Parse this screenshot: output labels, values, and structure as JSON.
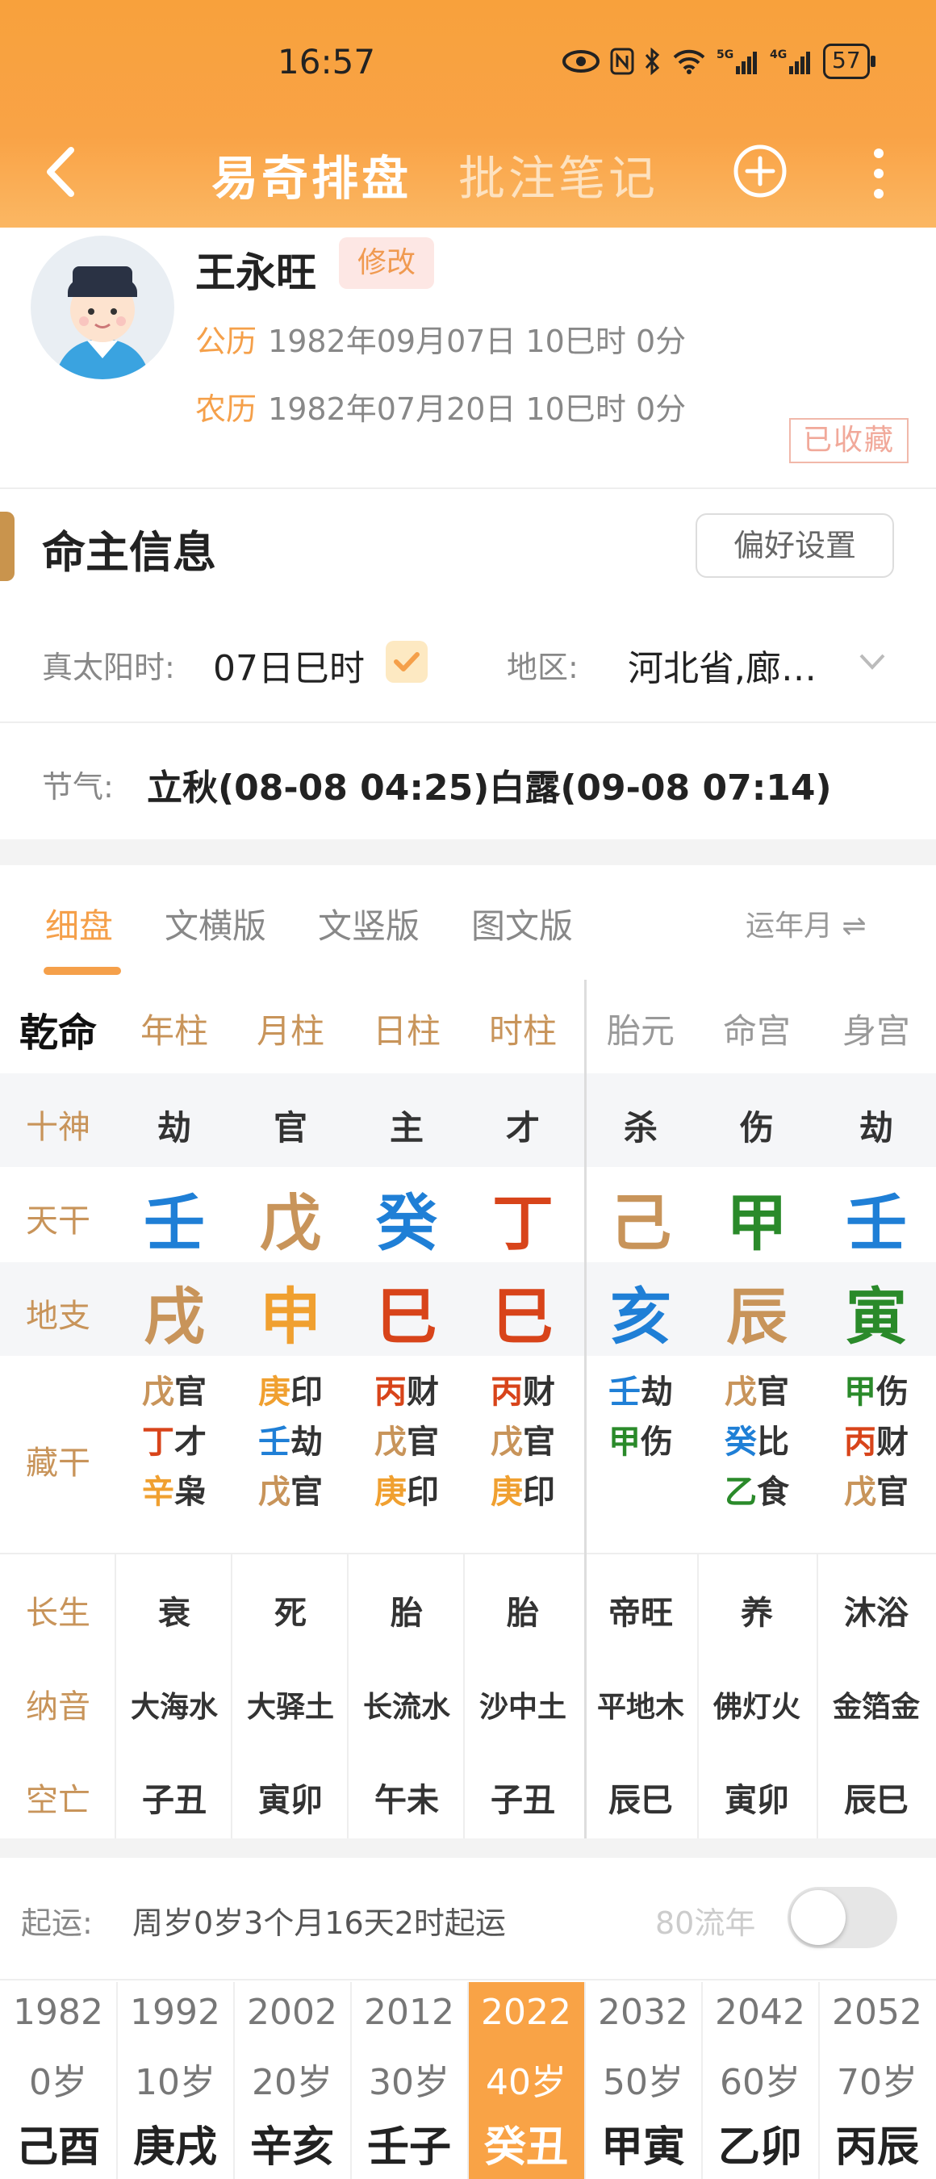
{
  "status_bar": {
    "time": "16:57",
    "battery": "57"
  },
  "nav": {
    "title": "易奇排盘",
    "tab2": "批注笔记"
  },
  "profile": {
    "name": "王永旺",
    "edit": "修改",
    "solar_label": "公历",
    "solar_value": "1982年09月07日 10巳时 0分",
    "lunar_label": "农历",
    "lunar_value": "1982年07月20日 10巳时 0分",
    "stamp": "已收藏"
  },
  "section": {
    "title": "命主信息",
    "pref_button": "偏好设置"
  },
  "info": {
    "true_solar_label": "真太阳时:",
    "true_solar_value": "07日巳时",
    "region_label": "地区:",
    "region_value": "河北省,廊…",
    "jieqi_label": "节气:",
    "jieqi_value": "立秋(08-08 04:25)白露(09-08 07:14)"
  },
  "tabs": {
    "items": [
      "细盘",
      "文横版",
      "文竖版",
      "图文版"
    ],
    "active": 0,
    "right": "运年月 ⇌"
  },
  "chart": {
    "corner": "乾命",
    "headers": [
      "年柱",
      "月柱",
      "日柱",
      "时柱",
      "胎元",
      "命宫",
      "身宫"
    ],
    "rows": {
      "shishen": {
        "label": "十神",
        "values": [
          "劫",
          "官",
          "主",
          "才",
          "杀",
          "伤",
          "劫"
        ]
      },
      "tiangan": {
        "label": "天干",
        "values": [
          "壬",
          "戊",
          "癸",
          "丁",
          "己",
          "甲",
          "壬"
        ],
        "colors": [
          "blue",
          "tan",
          "blue",
          "red",
          "tan",
          "grn",
          "blue"
        ]
      },
      "dizhi": {
        "label": "地支",
        "values": [
          "戌",
          "申",
          "巳",
          "巳",
          "亥",
          "辰",
          "寅"
        ],
        "colors": [
          "tan",
          "org",
          "red",
          "red",
          "blue",
          "tan",
          "grn"
        ]
      },
      "canggan": {
        "label": "藏干",
        "cols": [
          [
            [
              "戊",
              "官",
              "tan"
            ],
            [
              "丁",
              "才",
              "red"
            ],
            [
              "辛",
              "枭",
              "org"
            ]
          ],
          [
            [
              "庚",
              "印",
              "org"
            ],
            [
              "壬",
              "劫",
              "blue"
            ],
            [
              "戊",
              "官",
              "tan"
            ]
          ],
          [
            [
              "丙",
              "财",
              "red"
            ],
            [
              "戊",
              "官",
              "tan"
            ],
            [
              "庚",
              "印",
              "org"
            ]
          ],
          [
            [
              "丙",
              "财",
              "red"
            ],
            [
              "戊",
              "官",
              "tan"
            ],
            [
              "庚",
              "印",
              "org"
            ]
          ],
          [
            [
              "壬",
              "劫",
              "blue"
            ],
            [
              "甲",
              "伤",
              "grn"
            ]
          ],
          [
            [
              "戊",
              "官",
              "tan"
            ],
            [
              "癸",
              "比",
              "blue"
            ],
            [
              "乙",
              "食",
              "grn"
            ]
          ],
          [
            [
              "甲",
              "伤",
              "grn"
            ],
            [
              "丙",
              "财",
              "red"
            ],
            [
              "戊",
              "官",
              "tan"
            ]
          ]
        ]
      },
      "changsheng": {
        "label": "长生",
        "values": [
          "衰",
          "死",
          "胎",
          "胎",
          "帝旺",
          "养",
          "沐浴"
        ]
      },
      "nayin": {
        "label": "纳音",
        "values": [
          "大海水",
          "大驿土",
          "长流水",
          "沙中土",
          "平地木",
          "佛灯火",
          "金箔金"
        ]
      },
      "kongwang": {
        "label": "空亡",
        "values": [
          "子丑",
          "寅卯",
          "午未",
          "子丑",
          "辰巳",
          "寅卯",
          "辰巳"
        ]
      }
    }
  },
  "qiyun": {
    "label": "起运:",
    "value": "周岁0岁3个月16天2时起运",
    "toggle_label": "80流年"
  },
  "dayun": {
    "selected": 4,
    "items": [
      {
        "year": "1982",
        "age": "0岁",
        "gz": "己酉"
      },
      {
        "year": "1992",
        "age": "10岁",
        "gz": "庚戌"
      },
      {
        "year": "2002",
        "age": "20岁",
        "gz": "辛亥"
      },
      {
        "year": "2012",
        "age": "30岁",
        "gz": "壬子"
      },
      {
        "year": "2022",
        "age": "40岁",
        "gz": "癸丑"
      },
      {
        "year": "2032",
        "age": "50岁",
        "gz": "甲寅"
      },
      {
        "year": "2042",
        "age": "60岁",
        "gz": "乙卯"
      },
      {
        "year": "2052",
        "age": "70岁",
        "gz": "丙辰"
      }
    ]
  }
}
